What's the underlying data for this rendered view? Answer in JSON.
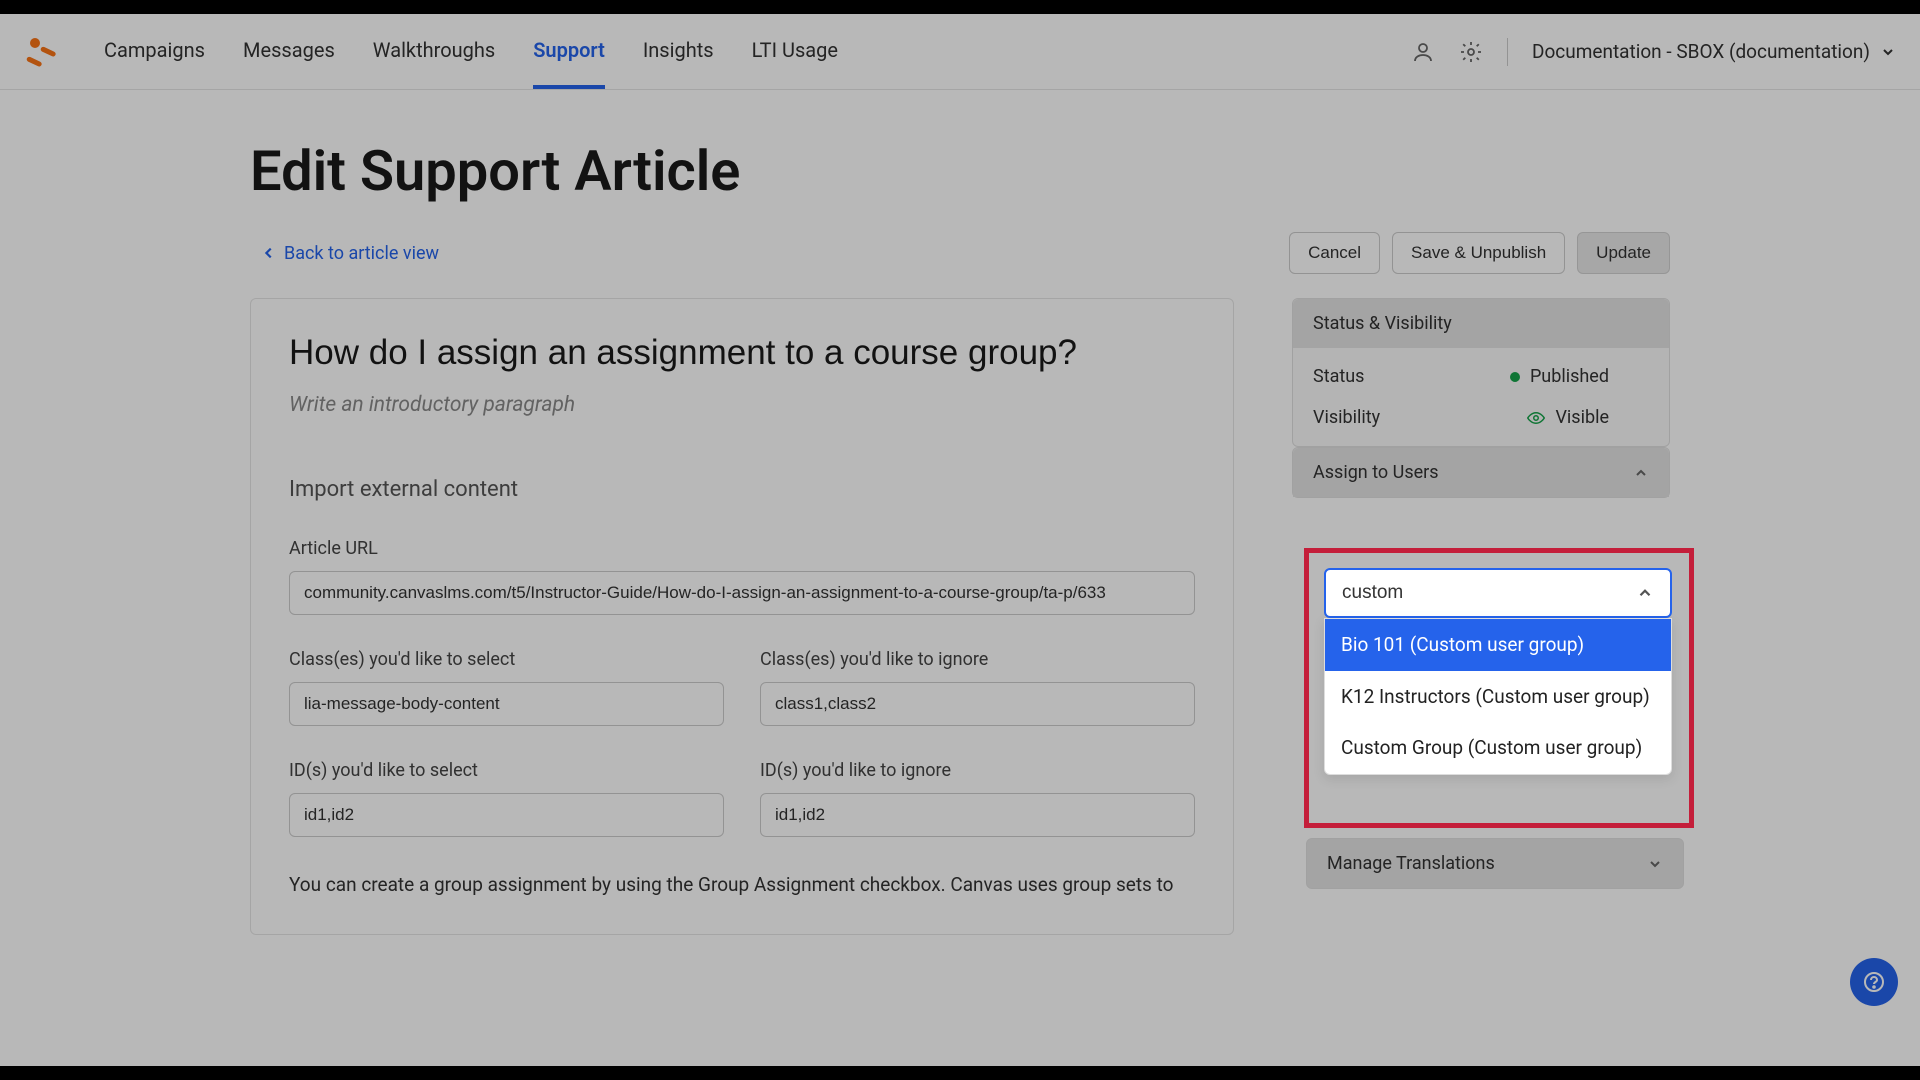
{
  "nav": {
    "items": [
      "Campaigns",
      "Messages",
      "Walkthroughs",
      "Support",
      "Insights",
      "LTI Usage"
    ],
    "active_index": 3
  },
  "workspace_label": "Documentation - SBOX (documentation)",
  "page_title": "Edit Support Article",
  "back_link": "Back to article view",
  "actions": {
    "cancel": "Cancel",
    "save_unpublish": "Save & Unpublish",
    "update": "Update"
  },
  "article": {
    "title": "How do I assign an assignment to a course group?",
    "intro_placeholder": "Write an introductory paragraph",
    "import_label": "Import external content",
    "url_label": "Article URL",
    "url_value": "community.canvaslms.com/t5/Instructor-Guide/How-do-I-assign-an-assignment-to-a-course-group/ta-p/633",
    "class_select_label": "Class(es) you'd like to select",
    "class_select_value": "lia-message-body-content",
    "class_ignore_label": "Class(es) you'd like to ignore",
    "class_ignore_value": "class1,class2",
    "id_select_label": "ID(s) you'd like to select",
    "id_select_value": "id1,id2",
    "id_ignore_label": "ID(s) you'd like to ignore",
    "id_ignore_value": "id1,id2",
    "body_preview": "You can create a group assignment by using the Group Assignment checkbox. Canvas uses group sets to"
  },
  "sidebar": {
    "status_panel": {
      "header": "Status & Visibility",
      "status_label": "Status",
      "status_value": "Published",
      "visibility_label": "Visibility",
      "visibility_value": "Visible"
    },
    "assign_panel": {
      "header": "Assign to Users",
      "search_value": "custom",
      "options": [
        "Bio 101 (Custom user group)",
        "K12 Instructors (Custom user group)",
        "Custom Group (Custom user group)"
      ],
      "selected_index": 0
    },
    "translations_header": "Manage Translations"
  }
}
